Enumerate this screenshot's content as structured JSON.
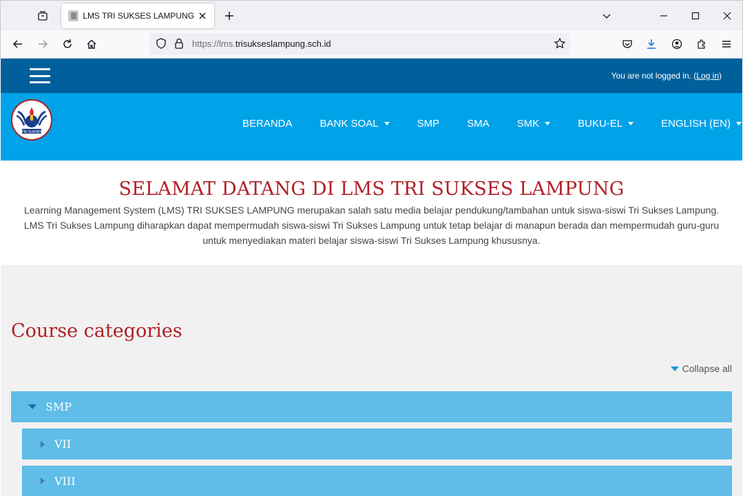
{
  "browser": {
    "tab_title": "LMS TRI SUKSES LAMPUNG",
    "url_prefix": "https://lms.",
    "url_domain": "trisukseslampung.sch.id"
  },
  "header": {
    "login_text": "You are not logged in. (",
    "login_link": "Log in",
    "login_suffix": ")"
  },
  "nav": {
    "items": [
      {
        "label": "BERANDA",
        "dropdown": false
      },
      {
        "label": "BANK SOAL",
        "dropdown": true
      },
      {
        "label": "SMP",
        "dropdown": false
      },
      {
        "label": "SMA",
        "dropdown": false
      },
      {
        "label": "SMK",
        "dropdown": true
      },
      {
        "label": "BUKU-EL",
        "dropdown": true
      },
      {
        "label": "ENGLISH (EN)",
        "dropdown": true
      }
    ],
    "logo_text": "TRI SUKSES"
  },
  "welcome": {
    "title": "SELAMAT DATANG DI LMS TRI SUKSES LAMPUNG",
    "text": "Learning Management System (LMS) TRI SUKSES LAMPUNG merupakan salah satu media belajar pendukung/tambahan untuk siswa-siswi Tri Sukses Lampung. LMS Tri Sukses Lampung diharapkan dapat mempermudah siswa-siswi Tri Sukses Lampung untuk tetap belajar di manapun berada dan mempermudah guru-guru untuk menyediakan materi belajar siswa-siswi Tri Sukses Lampung khususnya."
  },
  "categories": {
    "heading": "Course categories",
    "collapse_all": "Collapse all",
    "items": [
      {
        "label": "SMP",
        "expanded": true
      },
      {
        "label": "VII",
        "expanded": false
      },
      {
        "label": "VIII",
        "expanded": false
      }
    ]
  },
  "colors": {
    "topbar": "#00609b",
    "navbar": "#00a2e8",
    "title_red": "#b12026",
    "category_bg": "#5fbde7"
  }
}
